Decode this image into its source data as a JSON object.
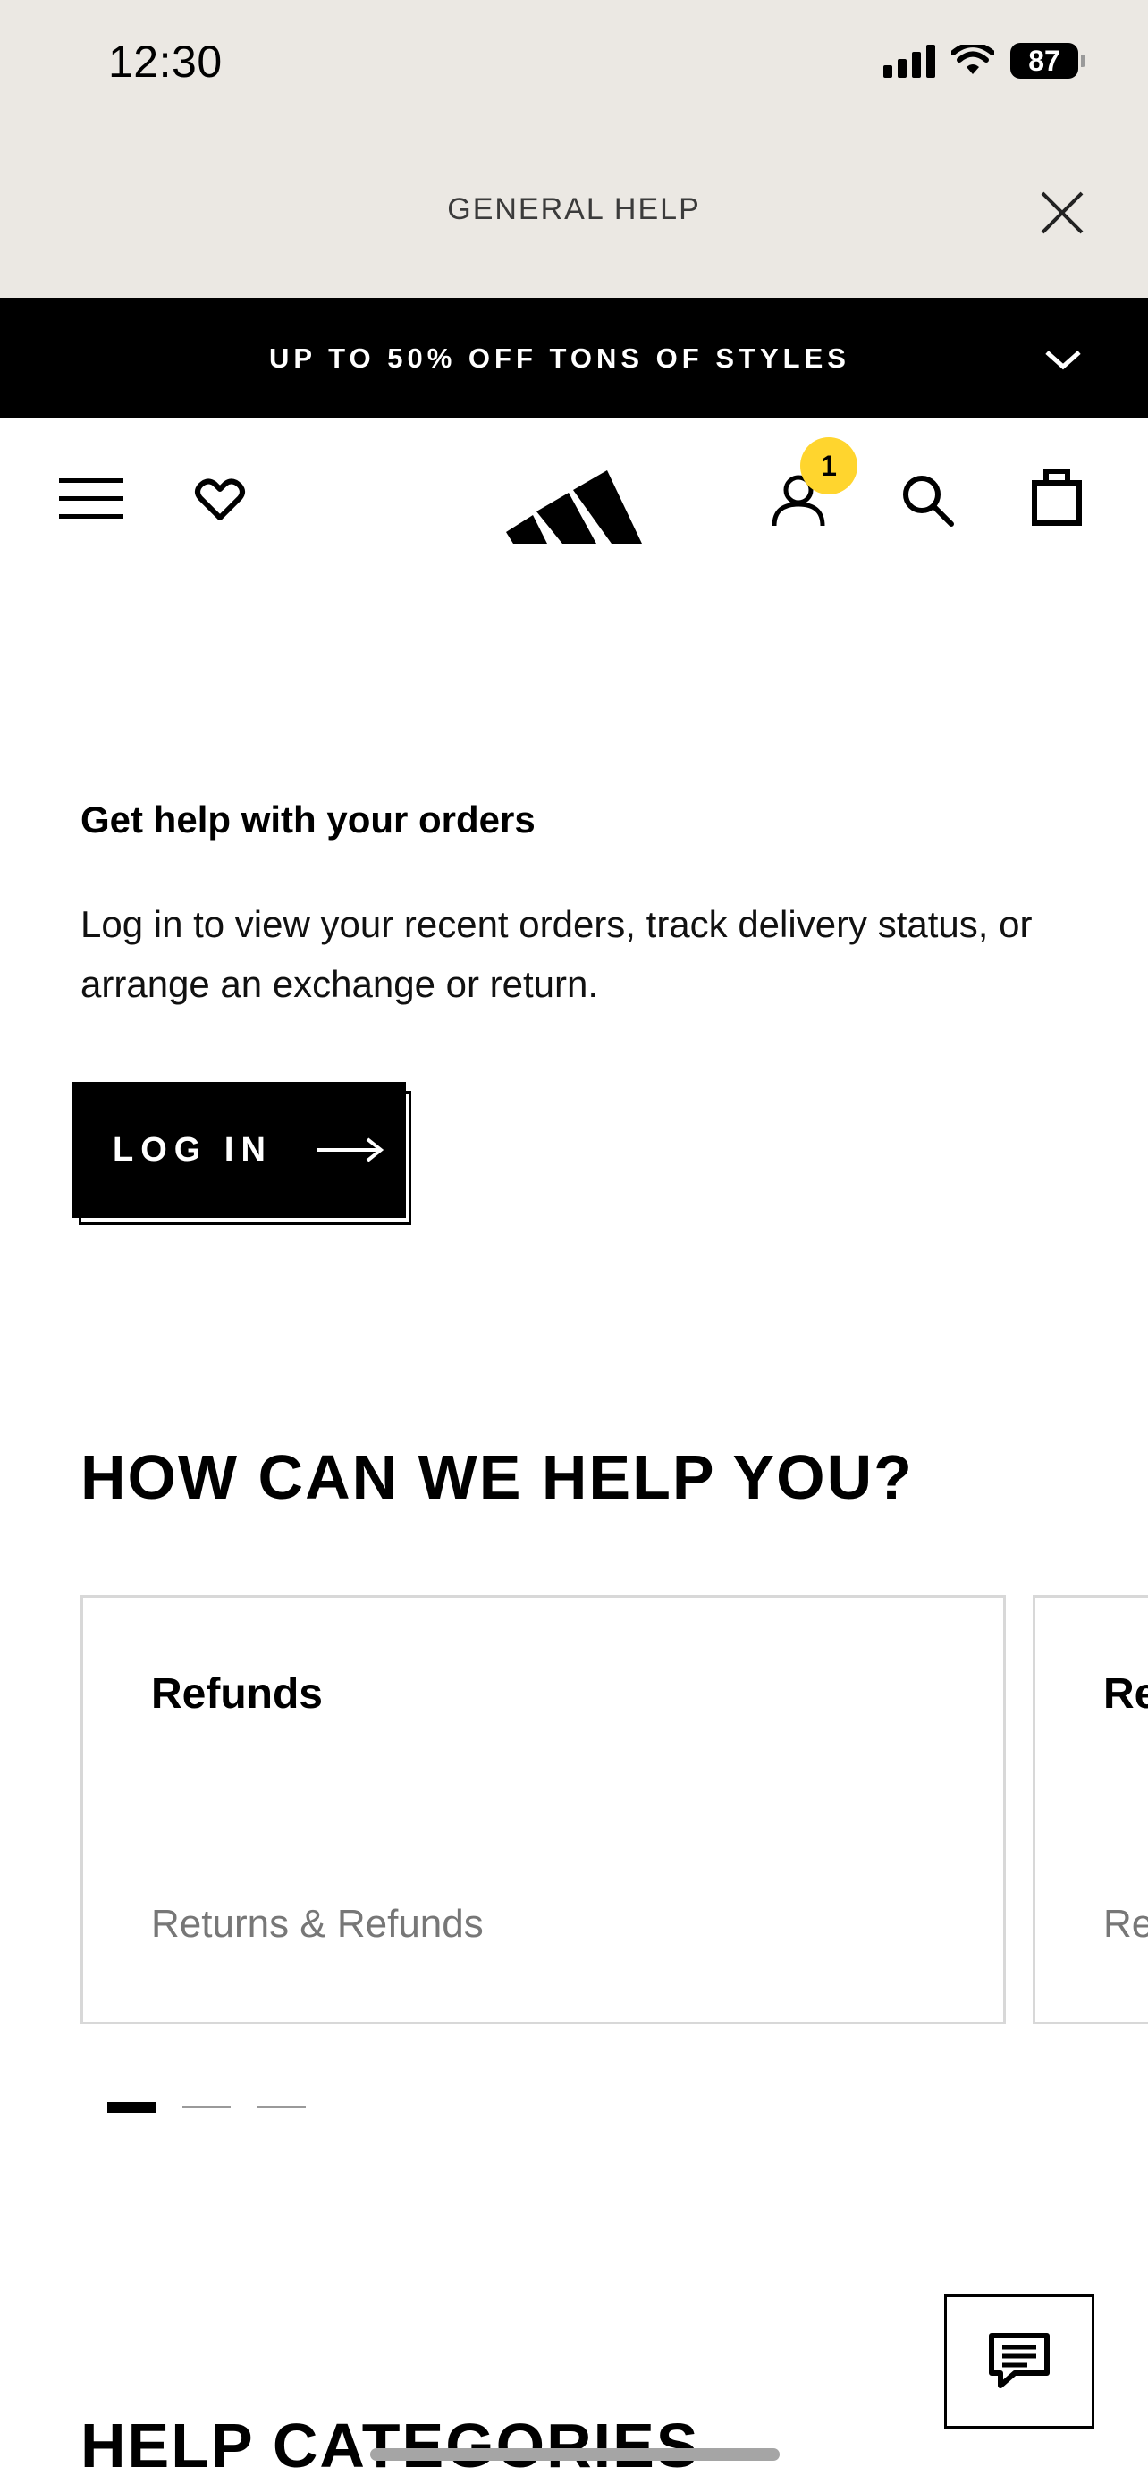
{
  "status_bar": {
    "time": "12:30",
    "battery": "87",
    "icons": [
      "cellular-signal-icon",
      "wifi-icon",
      "battery-icon"
    ]
  },
  "header": {
    "title": "GENERAL HELP",
    "close_icon": "close-icon"
  },
  "promo": {
    "text": "UP TO 50% OFF TONS OF STYLES",
    "icon": "chevron-down-icon"
  },
  "nav": {
    "icons": [
      "menu-icon",
      "wishlist-heart-icon",
      "adidas-logo",
      "account-icon",
      "search-icon",
      "bag-icon"
    ],
    "account_badge": "1",
    "badge_color": "#ffd52e"
  },
  "orders": {
    "title": "Get help with your orders",
    "description": "Log in to view your recent orders, track delivery status, or arrange an exchange or return.",
    "login_label": "LOG IN"
  },
  "help": {
    "heading": "HOW CAN WE HELP YOU?",
    "cards": [
      {
        "title": "Refunds",
        "category": "Returns & Refunds"
      },
      {
        "title": "Re",
        "category": "Re"
      }
    ],
    "carousel_pages": 3,
    "carousel_active": 1
  },
  "categories": {
    "heading": "HELP CATEGORIES"
  },
  "chat": {
    "icon": "chat-icon"
  }
}
